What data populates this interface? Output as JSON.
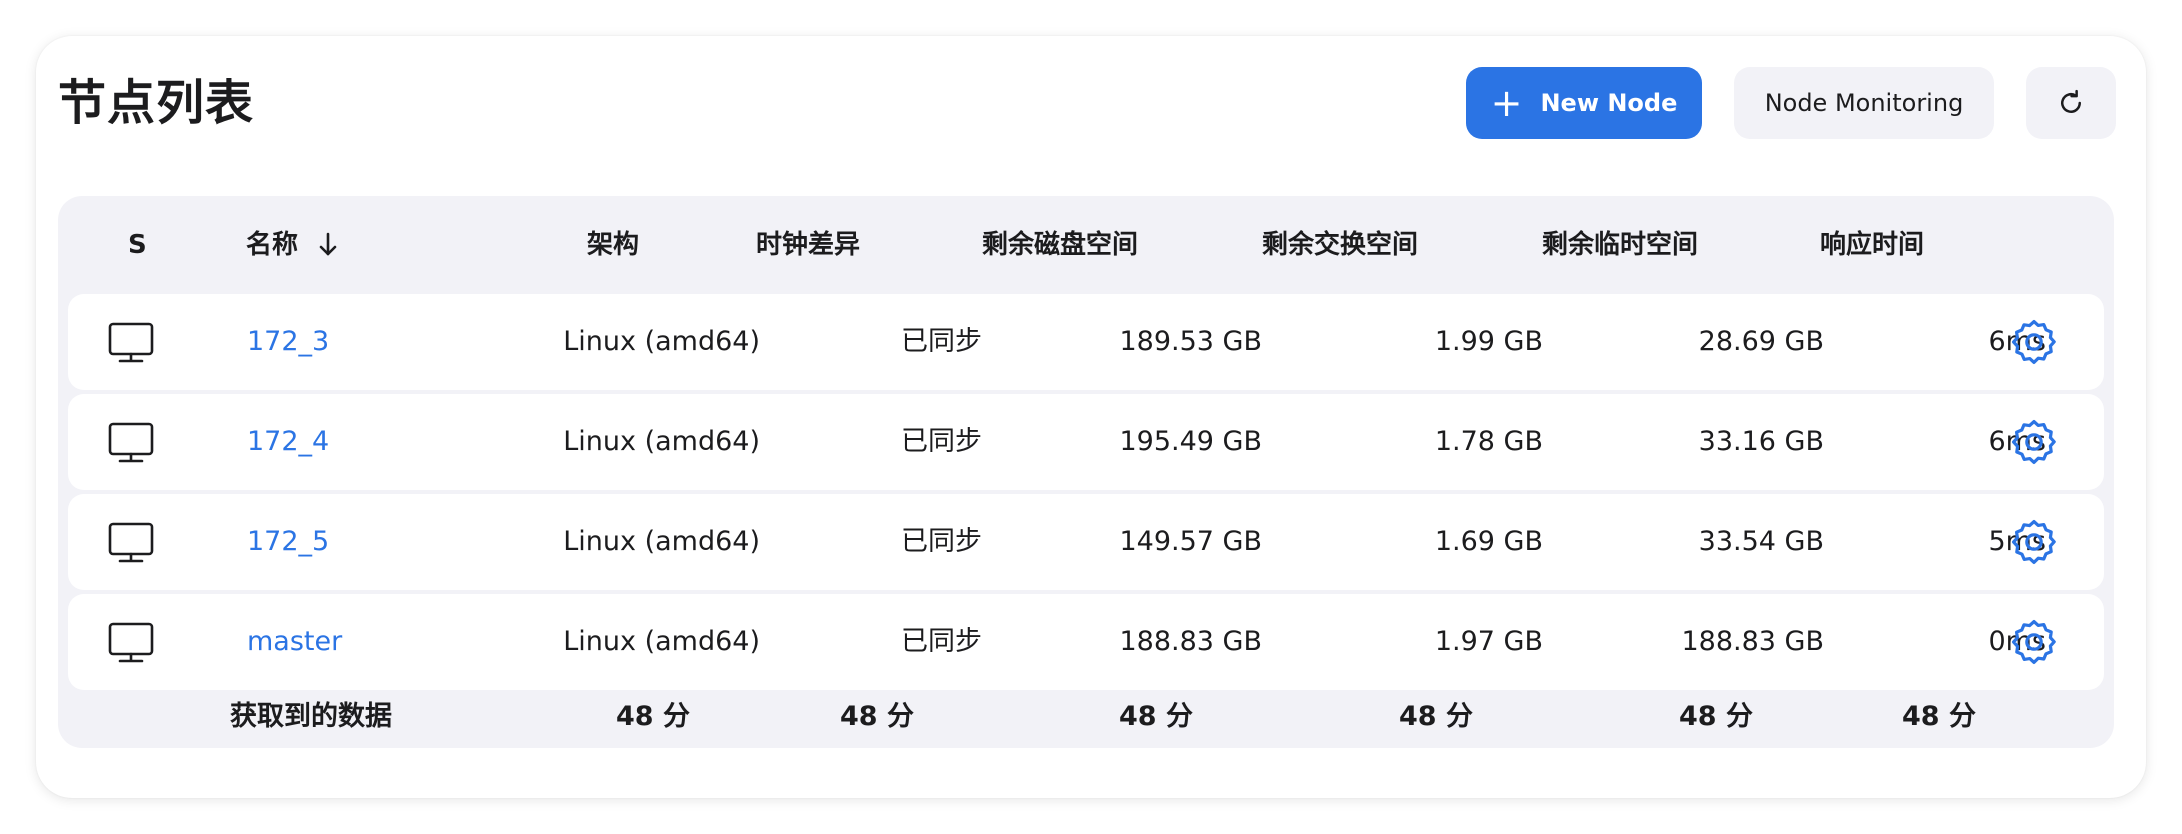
{
  "page": {
    "title": "节点列表"
  },
  "toolbar": {
    "new_node_label": "New Node",
    "new_node_icon": "plus-icon",
    "monitoring_label": "Node Monitoring",
    "refresh_icon": "refresh-icon"
  },
  "colors": {
    "accent": "#2b74e4",
    "panel_bg": "#f2f2f7",
    "secondary_button_bg": "#f2f2f7"
  },
  "table": {
    "headers": {
      "status": "S",
      "name": "名称",
      "arch": "架构",
      "clock": "时钟差异",
      "disk": "剩余磁盘空间",
      "swap": "剩余交换空间",
      "temp": "剩余临时空间",
      "response": "响应时间"
    },
    "sort": {
      "column": "name",
      "direction": "desc",
      "icon": "arrow-down-icon"
    },
    "rows": [
      {
        "status_icon": "monitor-icon",
        "name": "172_3",
        "arch": "Linux (amd64)",
        "clock": "已同步",
        "disk": "189.53 GB",
        "swap": "1.99 GB",
        "temp": "28.69 GB",
        "response": "6ms",
        "action_icon": "gear-icon"
      },
      {
        "status_icon": "monitor-icon",
        "name": "172_4",
        "arch": "Linux (amd64)",
        "clock": "已同步",
        "disk": "195.49 GB",
        "swap": "1.78 GB",
        "temp": "33.16 GB",
        "response": "6ms",
        "action_icon": "gear-icon"
      },
      {
        "status_icon": "monitor-icon",
        "name": "172_5",
        "arch": "Linux (amd64)",
        "clock": "已同步",
        "disk": "149.57 GB",
        "swap": "1.69 GB",
        "temp": "33.54 GB",
        "response": "5ms",
        "action_icon": "gear-icon"
      },
      {
        "status_icon": "monitor-icon",
        "name": "master",
        "arch": "Linux (amd64)",
        "clock": "已同步",
        "disk": "188.83 GB",
        "swap": "1.97 GB",
        "temp": "188.83 GB",
        "response": "0ms",
        "action_icon": "gear-icon"
      }
    ],
    "footer": {
      "label": "获取到的数据",
      "arch": "48 分",
      "clock": "48 分",
      "disk": "48 分",
      "swap": "48 分",
      "temp": "48 分",
      "response": "48 分"
    }
  }
}
